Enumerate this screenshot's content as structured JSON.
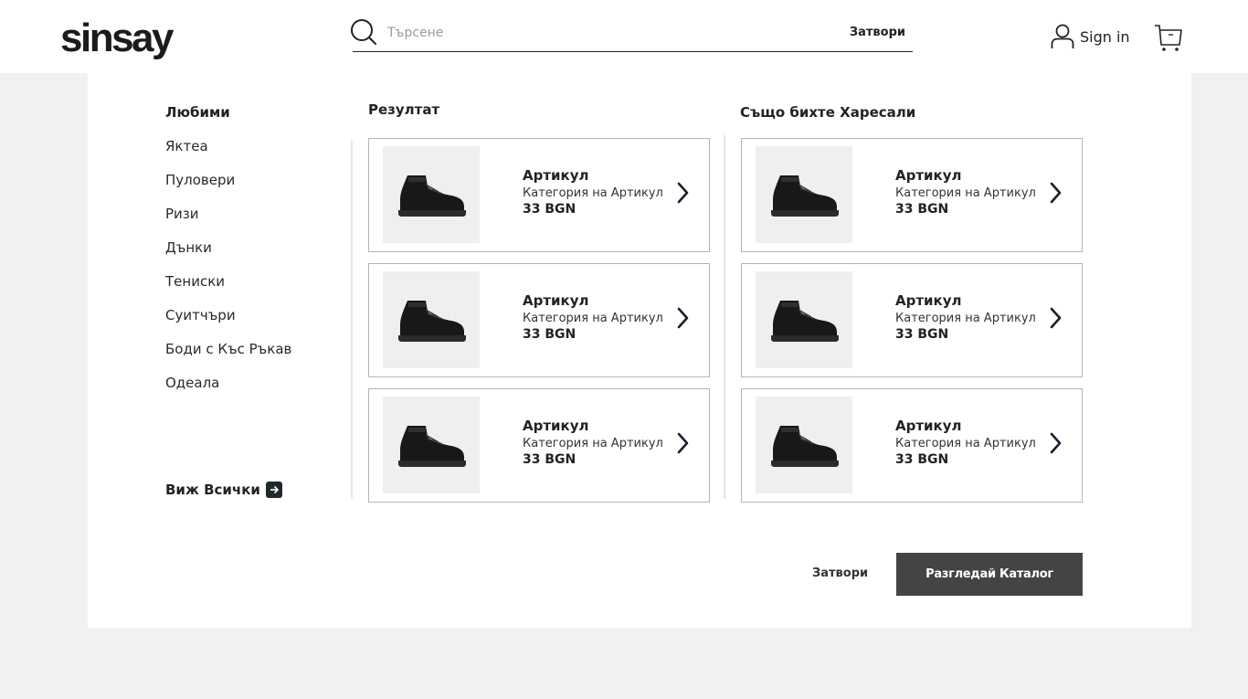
{
  "header": {
    "logo": "sinsay",
    "search_placeholder": "Търсене",
    "search_value": "",
    "search_close": "Затвори",
    "signin_label": "Sign in"
  },
  "favorites": {
    "title": "Любими",
    "items": [
      {
        "label": "Яктеа"
      },
      {
        "label": "Пуловери"
      },
      {
        "label": "Ризи"
      },
      {
        "label": "Дънки"
      },
      {
        "label": "Тениски"
      },
      {
        "label": "Суитчъри"
      },
      {
        "label": "Боди с Къс Ръкав"
      },
      {
        "label": "Одеала"
      }
    ],
    "view_all": "Виж Всички"
  },
  "results": {
    "title": "Резултат",
    "products": [
      {
        "name": "Артикул",
        "category": "Категория на Артикул",
        "price": "33 BGN"
      },
      {
        "name": "Артикул",
        "category": "Категория на Артикул",
        "price": "33 BGN"
      },
      {
        "name": "Артикул",
        "category": "Категория на Артикул",
        "price": "33 BGN"
      }
    ]
  },
  "suggestions": {
    "title": "Също бихте Харесали",
    "products": [
      {
        "name": "Артикул",
        "category": "Категория на Артикул",
        "price": "33 BGN"
      },
      {
        "name": "Артикул",
        "category": "Категория на Артикул",
        "price": "33 BGN"
      },
      {
        "name": "Артикул",
        "category": "Категория на Артикул",
        "price": "33 BGN"
      }
    ]
  },
  "footer": {
    "close_label": "Затвори",
    "catalog_label": "Разгледай Каталог"
  },
  "icons": {
    "search": "search-icon",
    "user": "user-icon",
    "cart": "cart-icon",
    "arrow": "chevron-right-icon",
    "view_all": "arrow-right-icon"
  },
  "colors": {
    "primary_button": "#444444",
    "page_background": "#f1f1f1",
    "card_border": "#b5b5b5",
    "image_background": "#efefef"
  }
}
